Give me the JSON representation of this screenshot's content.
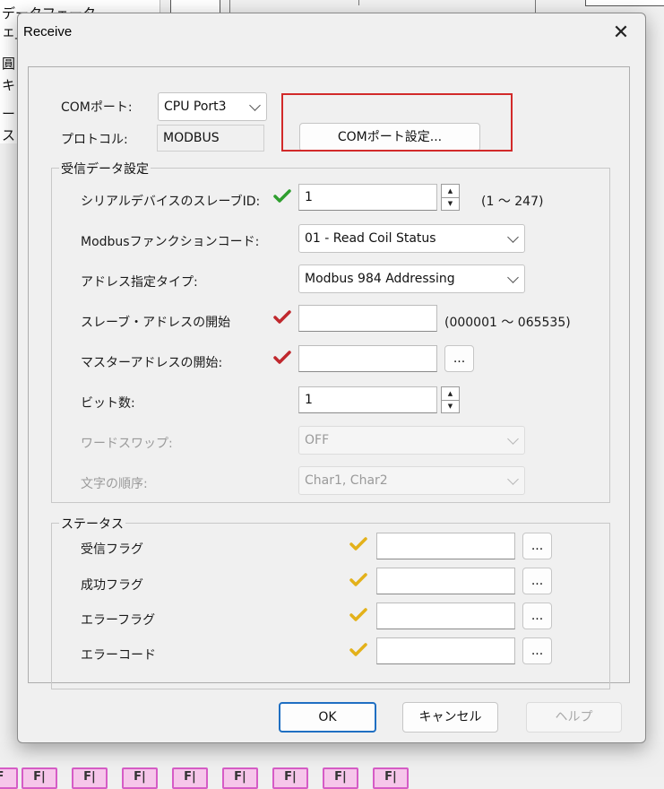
{
  "background_app": {
    "left_lines": [
      "データフェータ",
      "ェ_",
      "圓 デ",
      "キ",
      "ー",
      "ス"
    ],
    "bottom_cells": [
      "F",
      "F|",
      "F|",
      "F|",
      "F|",
      "F|",
      "F|",
      "F|",
      "F|"
    ]
  },
  "dialog": {
    "title": "Receive",
    "close_glyph": "✕",
    "com_port": {
      "label": "COMポート:",
      "value": "CPU Port3"
    },
    "protocol": {
      "label": "プロトコル:",
      "value": "MODBUS"
    },
    "com_settings_button": "COMポート設定...",
    "receive_group": {
      "title": "受信データ設定",
      "slave_id": {
        "label": "シリアルデバイスのスレーブID:",
        "value": "1",
        "range": "(1 ～ 247)"
      },
      "function_code": {
        "label": "Modbusファンクションコード:",
        "value": "01 - Read Coil Status"
      },
      "address_type": {
        "label": "アドレス指定タイプ:",
        "value": "Modbus 984 Addressing"
      },
      "slave_address_start": {
        "label": "スレーブ・アドレスの開始",
        "value": "",
        "range": "(000001 ～ 065535)"
      },
      "master_address_start": {
        "label": "マスターアドレスの開始:",
        "value": "",
        "browse": "..."
      },
      "bit_count": {
        "label": "ビット数:",
        "value": "1"
      },
      "word_swap": {
        "label": "ワードスワップ:",
        "value": "OFF"
      },
      "char_order": {
        "label": "文字の順序:",
        "value": "Char1, Char2"
      }
    },
    "status_group": {
      "title": "ステータス",
      "rows": [
        {
          "label": "受信フラグ",
          "value": "",
          "browse": "..."
        },
        {
          "label": "成功フラグ",
          "value": "",
          "browse": "..."
        },
        {
          "label": "エラーフラグ",
          "value": "",
          "browse": "..."
        },
        {
          "label": "エラーコード",
          "value": "",
          "browse": "..."
        }
      ]
    },
    "buttons": {
      "ok": "OK",
      "cancel": "キャンセル",
      "help": "ヘルプ"
    },
    "icons": {
      "check_green": "#2e9e2e",
      "check_red": "#c0282d",
      "check_yellow": "#e3b11a",
      "spin_up": "▲",
      "spin_down": "▼"
    }
  }
}
